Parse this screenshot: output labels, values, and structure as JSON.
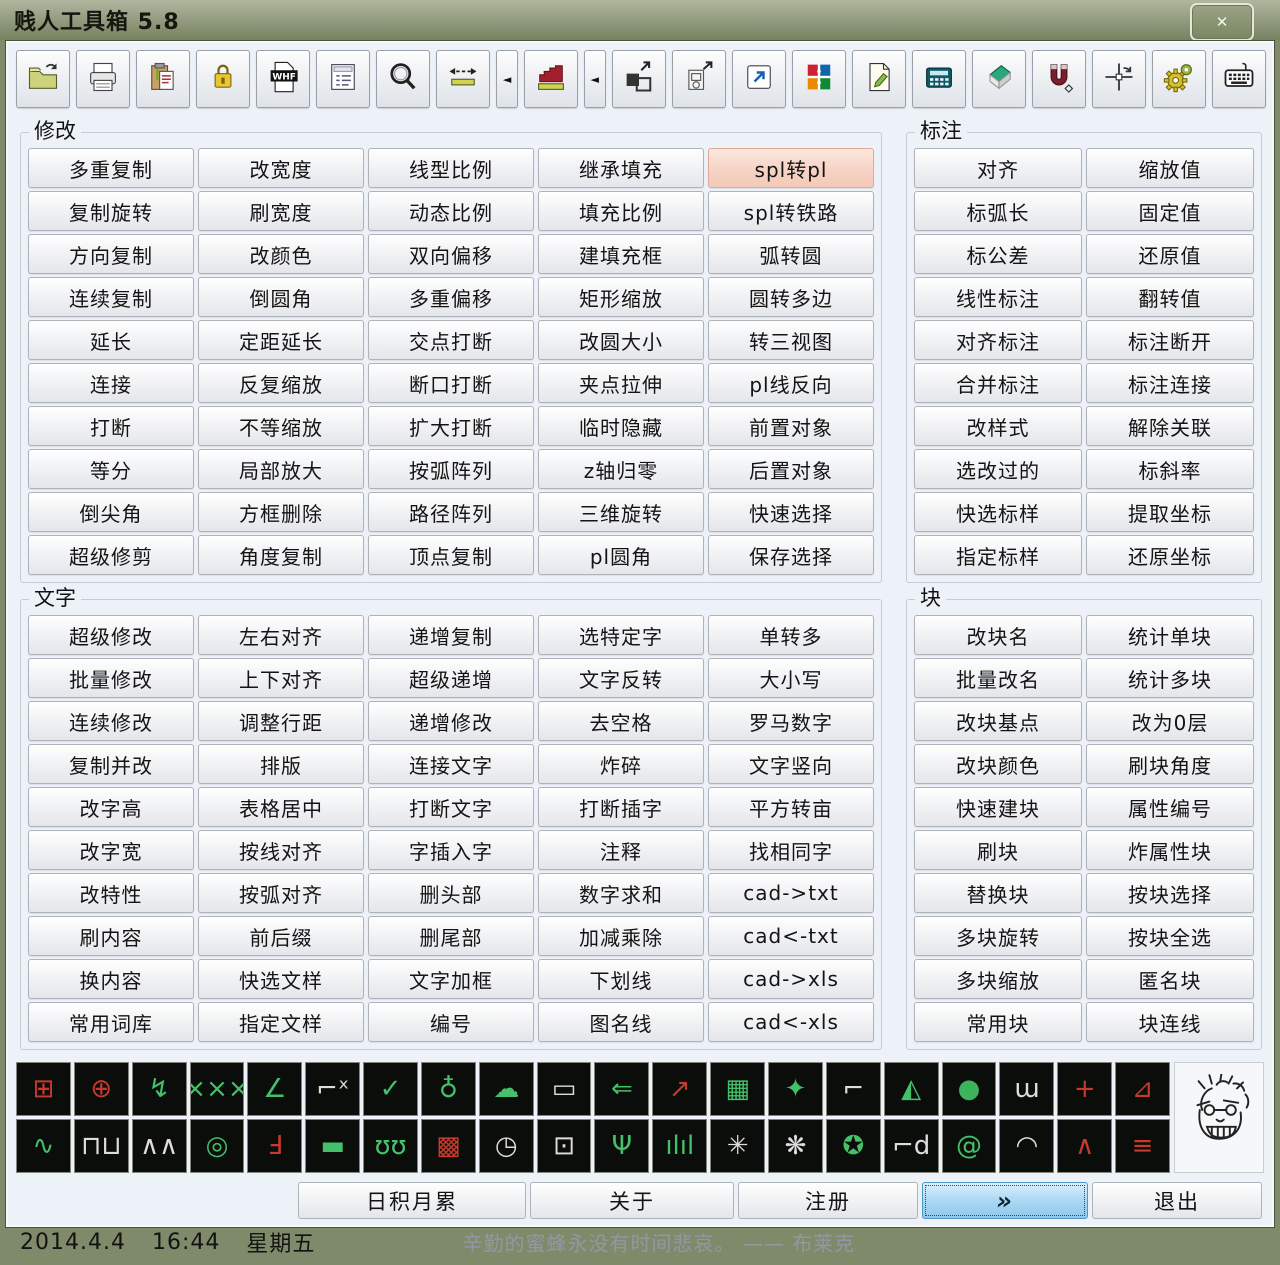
{
  "window": {
    "title": "贱人工具箱 5.8",
    "close_glyph": "✕"
  },
  "toolbar": {
    "items": [
      {
        "name": "open-folder-button",
        "icon": "open-folder-icon"
      },
      {
        "name": "printer-button",
        "icon": "printer-icon"
      },
      {
        "name": "clipboard-paste-button",
        "icon": "clipboard-paste-icon"
      },
      {
        "name": "lock-button",
        "icon": "lock-icon"
      },
      {
        "name": "whf-file-button",
        "icon": "whf-file-icon"
      },
      {
        "name": "list-document-button",
        "icon": "list-document-icon"
      },
      {
        "name": "magnifier-button",
        "icon": "magnifier-icon"
      },
      {
        "name": "measure-distance-button",
        "icon": "measure-distance-icon"
      },
      {
        "name": "flyout-arrow-button",
        "icon": "flyout-left-icon",
        "narrow": true,
        "glyph": "◄"
      },
      {
        "name": "area-chart-button",
        "icon": "area-chart-icon"
      },
      {
        "name": "flyout-arrow-button",
        "icon": "flyout-left-icon",
        "narrow": true,
        "glyph": "◄"
      },
      {
        "name": "move-resize-button",
        "icon": "move-resize-icon"
      },
      {
        "name": "id-card-arrows-button",
        "icon": "id-card-arrows-icon"
      },
      {
        "name": "open-external-button",
        "icon": "open-external-icon"
      },
      {
        "name": "color-grid-button",
        "icon": "color-grid-icon"
      },
      {
        "name": "document-edit-button",
        "icon": "document-edit-icon"
      },
      {
        "name": "calculator-button",
        "icon": "calculator-icon"
      },
      {
        "name": "eraser-button",
        "icon": "eraser-icon"
      },
      {
        "name": "magnet-button",
        "icon": "magnet-icon"
      },
      {
        "name": "crosshair-rotate-button",
        "icon": "crosshair-rotate-icon"
      },
      {
        "name": "gears-button",
        "icon": "gears-icon"
      },
      {
        "name": "keyboard-button",
        "icon": "keyboard-icon"
      }
    ]
  },
  "sections": [
    {
      "id": "modify",
      "label": "修改",
      "columns": 5,
      "buttons": [
        {
          "label": "多重复制"
        },
        {
          "label": "改宽度"
        },
        {
          "label": "线型比例"
        },
        {
          "label": "继承填充"
        },
        {
          "label": "spl转pl",
          "highlighted": true
        },
        {
          "label": "复制旋转"
        },
        {
          "label": "刷宽度"
        },
        {
          "label": "动态比例"
        },
        {
          "label": "填充比例"
        },
        {
          "label": "spl转铁路"
        },
        {
          "label": "方向复制"
        },
        {
          "label": "改颜色"
        },
        {
          "label": "双向偏移"
        },
        {
          "label": "建填充框"
        },
        {
          "label": "弧转圆"
        },
        {
          "label": "连续复制"
        },
        {
          "label": "倒圆角"
        },
        {
          "label": "多重偏移"
        },
        {
          "label": "矩形缩放"
        },
        {
          "label": "圆转多边"
        },
        {
          "label": "延长"
        },
        {
          "label": "定距延长"
        },
        {
          "label": "交点打断"
        },
        {
          "label": "改圆大小"
        },
        {
          "label": "转三视图"
        },
        {
          "label": "连接"
        },
        {
          "label": "反复缩放"
        },
        {
          "label": "断口打断"
        },
        {
          "label": "夹点拉伸"
        },
        {
          "label": "pl线反向"
        },
        {
          "label": "打断"
        },
        {
          "label": "不等缩放"
        },
        {
          "label": "扩大打断"
        },
        {
          "label": "临时隐藏"
        },
        {
          "label": "前置对象"
        },
        {
          "label": "等分"
        },
        {
          "label": "局部放大"
        },
        {
          "label": "按弧阵列"
        },
        {
          "label": "z轴归零"
        },
        {
          "label": "后置对象"
        },
        {
          "label": "倒尖角"
        },
        {
          "label": "方框删除"
        },
        {
          "label": "路径阵列"
        },
        {
          "label": "三维旋转"
        },
        {
          "label": "快速选择"
        },
        {
          "label": "超级修剪"
        },
        {
          "label": "角度复制"
        },
        {
          "label": "顶点复制"
        },
        {
          "label": "pl圆角"
        },
        {
          "label": "保存选择"
        }
      ]
    },
    {
      "id": "dimension",
      "label": "标注",
      "columns": 2,
      "buttons": [
        {
          "label": "对齐"
        },
        {
          "label": "缩放值"
        },
        {
          "label": "标弧长"
        },
        {
          "label": "固定值"
        },
        {
          "label": "标公差"
        },
        {
          "label": "还原值"
        },
        {
          "label": "线性标注"
        },
        {
          "label": "翻转值"
        },
        {
          "label": "对齐标注"
        },
        {
          "label": "标注断开"
        },
        {
          "label": "合并标注"
        },
        {
          "label": "标注连接"
        },
        {
          "label": "改样式"
        },
        {
          "label": "解除关联"
        },
        {
          "label": "选改过的"
        },
        {
          "label": "标斜率"
        },
        {
          "label": "快选标样"
        },
        {
          "label": "提取坐标"
        },
        {
          "label": "指定标样"
        },
        {
          "label": "还原坐标"
        }
      ]
    },
    {
      "id": "text",
      "label": "文字",
      "columns": 5,
      "buttons": [
        {
          "label": "超级修改"
        },
        {
          "label": "左右对齐"
        },
        {
          "label": "递增复制"
        },
        {
          "label": "选特定字"
        },
        {
          "label": "单转多"
        },
        {
          "label": "批量修改"
        },
        {
          "label": "上下对齐"
        },
        {
          "label": "超级递增"
        },
        {
          "label": "文字反转"
        },
        {
          "label": "大小写"
        },
        {
          "label": "连续修改"
        },
        {
          "label": "调整行距"
        },
        {
          "label": "递增修改"
        },
        {
          "label": "去空格"
        },
        {
          "label": "罗马数字"
        },
        {
          "label": "复制并改"
        },
        {
          "label": "排版"
        },
        {
          "label": "连接文字"
        },
        {
          "label": "炸碎"
        },
        {
          "label": "文字竖向"
        },
        {
          "label": "改字高"
        },
        {
          "label": "表格居中"
        },
        {
          "label": "打断文字"
        },
        {
          "label": "打断插字"
        },
        {
          "label": "平方转亩"
        },
        {
          "label": "改字宽"
        },
        {
          "label": "按线对齐"
        },
        {
          "label": "字插入字"
        },
        {
          "label": "注释"
        },
        {
          "label": "找相同字"
        },
        {
          "label": "改特性"
        },
        {
          "label": "按弧对齐"
        },
        {
          "label": "删头部"
        },
        {
          "label": "数字求和"
        },
        {
          "label": "cad->txt"
        },
        {
          "label": "刷内容"
        },
        {
          "label": "前后缀"
        },
        {
          "label": "删尾部"
        },
        {
          "label": "加减乘除"
        },
        {
          "label": "cad<-txt"
        },
        {
          "label": "换内容"
        },
        {
          "label": "快选文样"
        },
        {
          "label": "文字加框"
        },
        {
          "label": "下划线"
        },
        {
          "label": "cad->xls"
        },
        {
          "label": "常用词库"
        },
        {
          "label": "指定文样"
        },
        {
          "label": "编号"
        },
        {
          "label": "图名线"
        },
        {
          "label": "cad<-xls"
        }
      ]
    },
    {
      "id": "block",
      "label": "块",
      "columns": 2,
      "buttons": [
        {
          "label": "改块名"
        },
        {
          "label": "统计单块"
        },
        {
          "label": "批量改名"
        },
        {
          "label": "统计多块"
        },
        {
          "label": "改块基点"
        },
        {
          "label": "改为0层"
        },
        {
          "label": "改块颜色"
        },
        {
          "label": "刷块角度"
        },
        {
          "label": "快速建块"
        },
        {
          "label": "属性编号"
        },
        {
          "label": "刷块"
        },
        {
          "label": "炸属性块"
        },
        {
          "label": "替换块"
        },
        {
          "label": "按块选择"
        },
        {
          "label": "多块旋转"
        },
        {
          "label": "按块全选"
        },
        {
          "label": "多块缩放"
        },
        {
          "label": "匿名块"
        },
        {
          "label": "常用块"
        },
        {
          "label": "块连线"
        }
      ]
    }
  ],
  "icon_strip": {
    "tiles": [
      {
        "name": "grid-crosshair-icon",
        "glyph": "⊞",
        "color": "#c8392c"
      },
      {
        "name": "circle-target-icon",
        "glyph": "⊕",
        "color": "#c8392c"
      },
      {
        "name": "break-line-icon",
        "glyph": "↯",
        "color": "#45c06a"
      },
      {
        "name": "fence-xxx-icon",
        "glyph": "×××",
        "color": "#45c06a"
      },
      {
        "name": "slope-symbol-icon",
        "glyph": "∠",
        "color": "#45c06a"
      },
      {
        "name": "coordinate-marks-icon",
        "glyph": "⌐ˣ",
        "color": "#dddddd"
      },
      {
        "name": "check-level-icon",
        "glyph": "✓",
        "color": "#45c06a"
      },
      {
        "name": "tree-symbol-icon",
        "glyph": "♁",
        "color": "#45c06a"
      },
      {
        "name": "revision-cloud-icon",
        "glyph": "☁",
        "color": "#45c06a"
      },
      {
        "name": "callout-bubble-icon",
        "glyph": "▭",
        "color": "#dddddd"
      },
      {
        "name": "left-arrow-icon",
        "glyph": "⇐",
        "color": "#45c06a"
      },
      {
        "name": "curve-chart-icon",
        "glyph": "↗",
        "color": "#c8392c"
      },
      {
        "name": "table-grid-icon",
        "glyph": "▦",
        "color": "#45c06a"
      },
      {
        "name": "star4-icon",
        "glyph": "✦",
        "color": "#45c06a"
      },
      {
        "name": "stairs-icon",
        "glyph": "⌐",
        "color": "#dddddd"
      },
      {
        "name": "compass-needle-icon",
        "glyph": "◭",
        "color": "#45c06a"
      },
      {
        "name": "dot-blob-icon",
        "glyph": "●",
        "color": "#3db45c"
      },
      {
        "name": "coil-top-icon",
        "glyph": "ɯ",
        "color": "#dddddd"
      },
      {
        "name": "red-cross-icon",
        "glyph": "+",
        "color": "#c8392c"
      },
      {
        "name": "line-graph-icon",
        "glyph": "⊿",
        "color": "#c8392c"
      },
      {
        "name": "sine-wave-icon",
        "glyph": "∿",
        "color": "#45c06a"
      },
      {
        "name": "square-wave-icon",
        "glyph": "⊓⊔",
        "color": "#dddddd"
      },
      {
        "name": "zigzag-icon",
        "glyph": "∧∧",
        "color": "#dddddd"
      },
      {
        "name": "concentric-circles-icon",
        "glyph": "◎",
        "color": "#45c06a"
      },
      {
        "name": "section-hook-icon",
        "glyph": "Ⅎ",
        "color": "#c8392c"
      },
      {
        "name": "thick-line-icon",
        "glyph": "▬",
        "color": "#45c06a"
      },
      {
        "name": "spring-coil-icon",
        "glyph": "ʊʊ",
        "color": "#45c06a"
      },
      {
        "name": "hatched-square-icon",
        "glyph": "▩",
        "color": "#c8392c"
      },
      {
        "name": "clock-icon",
        "glyph": "◷",
        "color": "#dddddd"
      },
      {
        "name": "rect-dot-icon",
        "glyph": "⊡",
        "color": "#dddddd"
      },
      {
        "name": "tree-branch-icon",
        "glyph": "Ψ",
        "color": "#45c06a"
      },
      {
        "name": "signal-noise-icon",
        "glyph": "ılıl",
        "color": "#45c06a"
      },
      {
        "name": "gear-flower-icon",
        "glyph": "✳",
        "color": "#dddddd"
      },
      {
        "name": "gear-star-icon",
        "glyph": "❋",
        "color": "#dddddd"
      },
      {
        "name": "circle-star-icon",
        "glyph": "✪",
        "color": "#45c06a"
      },
      {
        "name": "step-d-icon",
        "glyph": "⌐d",
        "color": "#dddddd"
      },
      {
        "name": "spiral-icon",
        "glyph": "@",
        "color": "#45c06a"
      },
      {
        "name": "gauge-arc-icon",
        "glyph": "◠",
        "color": "#dddddd"
      },
      {
        "name": "peak-lines-icon",
        "glyph": "∧",
        "color": "#c8392c"
      },
      {
        "name": "red-text-lines-icon",
        "glyph": "≡",
        "color": "#c8392c"
      }
    ]
  },
  "bottom_bar": {
    "buttons": [
      {
        "name": "daily-tips-button",
        "label": "日积月累"
      },
      {
        "name": "about-button",
        "label": "关于"
      },
      {
        "name": "register-button",
        "label": "注册"
      },
      {
        "name": "expand-button",
        "label": "»",
        "highlighted": true
      },
      {
        "name": "exit-button",
        "label": "退出"
      }
    ]
  },
  "status_bar": {
    "date": "2014.4.4",
    "time": "16:44",
    "weekday": "星期五",
    "quote": "辛勤的蜜蜂永没有时间悲哀。",
    "attribution": "—— 布莱克"
  },
  "colors": {
    "titlebar_olive": "#8d977d",
    "window_bg": "#edf1f8",
    "button_face": "#eef0f3",
    "highlight_pink": "#f6d2c3",
    "focus_blue": "#abd8f3",
    "tile_bg": "#0b0d0a",
    "tile_green": "#45c06a",
    "tile_red": "#c8392c"
  }
}
